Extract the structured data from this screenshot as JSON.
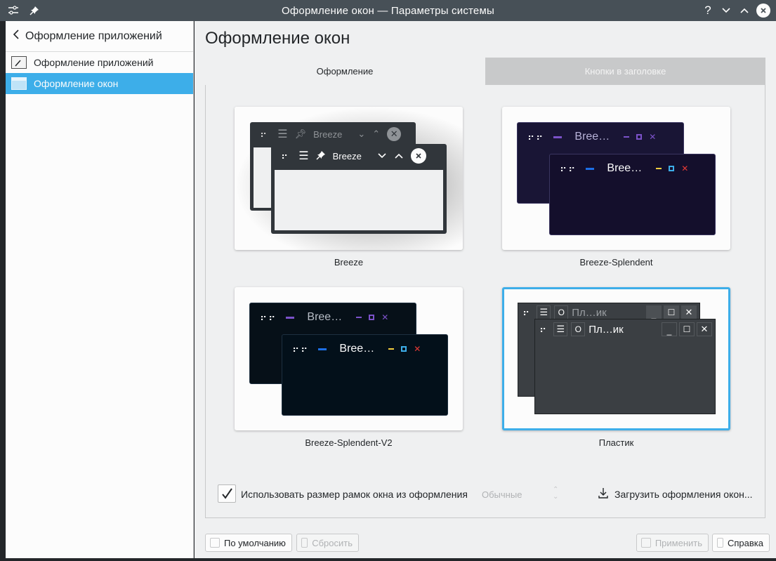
{
  "window": {
    "title": "Оформление окон — Параметры системы",
    "controls": {
      "help": "?"
    }
  },
  "sidebar": {
    "back_label": "Оформление приложений",
    "items": [
      {
        "label": "Оформление приложений",
        "icon": "app-style-icon",
        "active": false
      },
      {
        "label": "Оформление окон",
        "icon": "window-style-icon",
        "active": true
      }
    ]
  },
  "main": {
    "title": "Оформление окон",
    "tabs": [
      {
        "label": "Оформление",
        "active": true
      },
      {
        "label": "Кнопки в заголовке",
        "active": false
      }
    ],
    "themes": [
      {
        "name": "Breeze",
        "preview_title": "Breeze",
        "selected": false
      },
      {
        "name": "Breeze-Splendent",
        "preview_title": "Bree…",
        "selected": false
      },
      {
        "name": "Breeze-Splendent-V2",
        "preview_title": "Bree…",
        "selected": false
      },
      {
        "name": "Пластик",
        "preview_title": "Пл…ик",
        "selected": true
      }
    ],
    "use_border_size_label": "Использовать размер рамок окна из оформления",
    "use_border_size_checked": true,
    "border_size_value": "Обычные",
    "download_label": "Загрузить оформления окон..."
  },
  "footer": {
    "defaults": "По умолчанию",
    "reset": "Сбросить",
    "apply": "Применить",
    "help": "Справка"
  },
  "colors": {
    "accent": "#3daee9",
    "titlebar": "#475057",
    "window_bg": "#eff0f1"
  }
}
